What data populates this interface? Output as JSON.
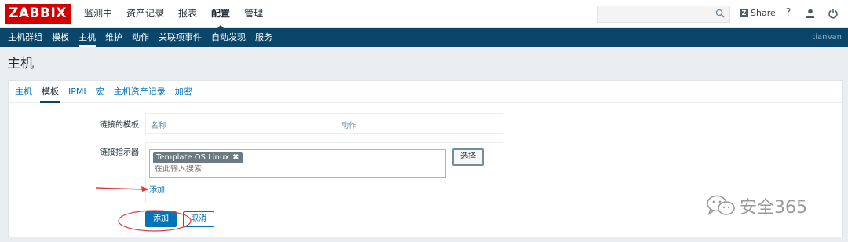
{
  "header": {
    "logo": "ZABBIX",
    "menu": [
      {
        "label": "监测中",
        "active": false
      },
      {
        "label": "资产记录",
        "active": false
      },
      {
        "label": "报表",
        "active": false
      },
      {
        "label": "配置",
        "active": true
      },
      {
        "label": "管理",
        "active": false
      }
    ],
    "search_value": "",
    "share_label": "Share",
    "share_badge": "Z",
    "help_icon": "?",
    "user_icon": "user-icon",
    "logout_icon": "power-icon"
  },
  "subnav": {
    "items": [
      {
        "label": "主机群组",
        "active": false
      },
      {
        "label": "模板",
        "active": false
      },
      {
        "label": "主机",
        "active": true
      },
      {
        "label": "维护",
        "active": false
      },
      {
        "label": "动作",
        "active": false
      },
      {
        "label": "关联项事件",
        "active": false
      },
      {
        "label": "自动发现",
        "active": false
      },
      {
        "label": "服务",
        "active": false
      }
    ],
    "username": "tianVan"
  },
  "page": {
    "title": "主机"
  },
  "tabs": [
    {
      "label": "主机",
      "active": false
    },
    {
      "label": "模板",
      "active": true
    },
    {
      "label": "IPMI",
      "active": false
    },
    {
      "label": "宏",
      "active": false
    },
    {
      "label": "主机资产记录",
      "active": false
    },
    {
      "label": "加密",
      "active": false
    }
  ],
  "form": {
    "linked_templates_label": "链接的模板",
    "linked_table": {
      "col_name": "名称",
      "col_action": "动作"
    },
    "link_new_label": "链接指示器",
    "selected_template": "Template OS Linux",
    "search_placeholder": "在此输入搜索",
    "select_button": "选择",
    "add_link": "添加",
    "add_button": "添加",
    "cancel_button": "取消"
  },
  "watermark": {
    "text": "安全365"
  },
  "colors": {
    "brand": "#d40000",
    "subnav_bg": "#0a466a",
    "link": "#0275b8",
    "annotation": "#e0393e"
  }
}
